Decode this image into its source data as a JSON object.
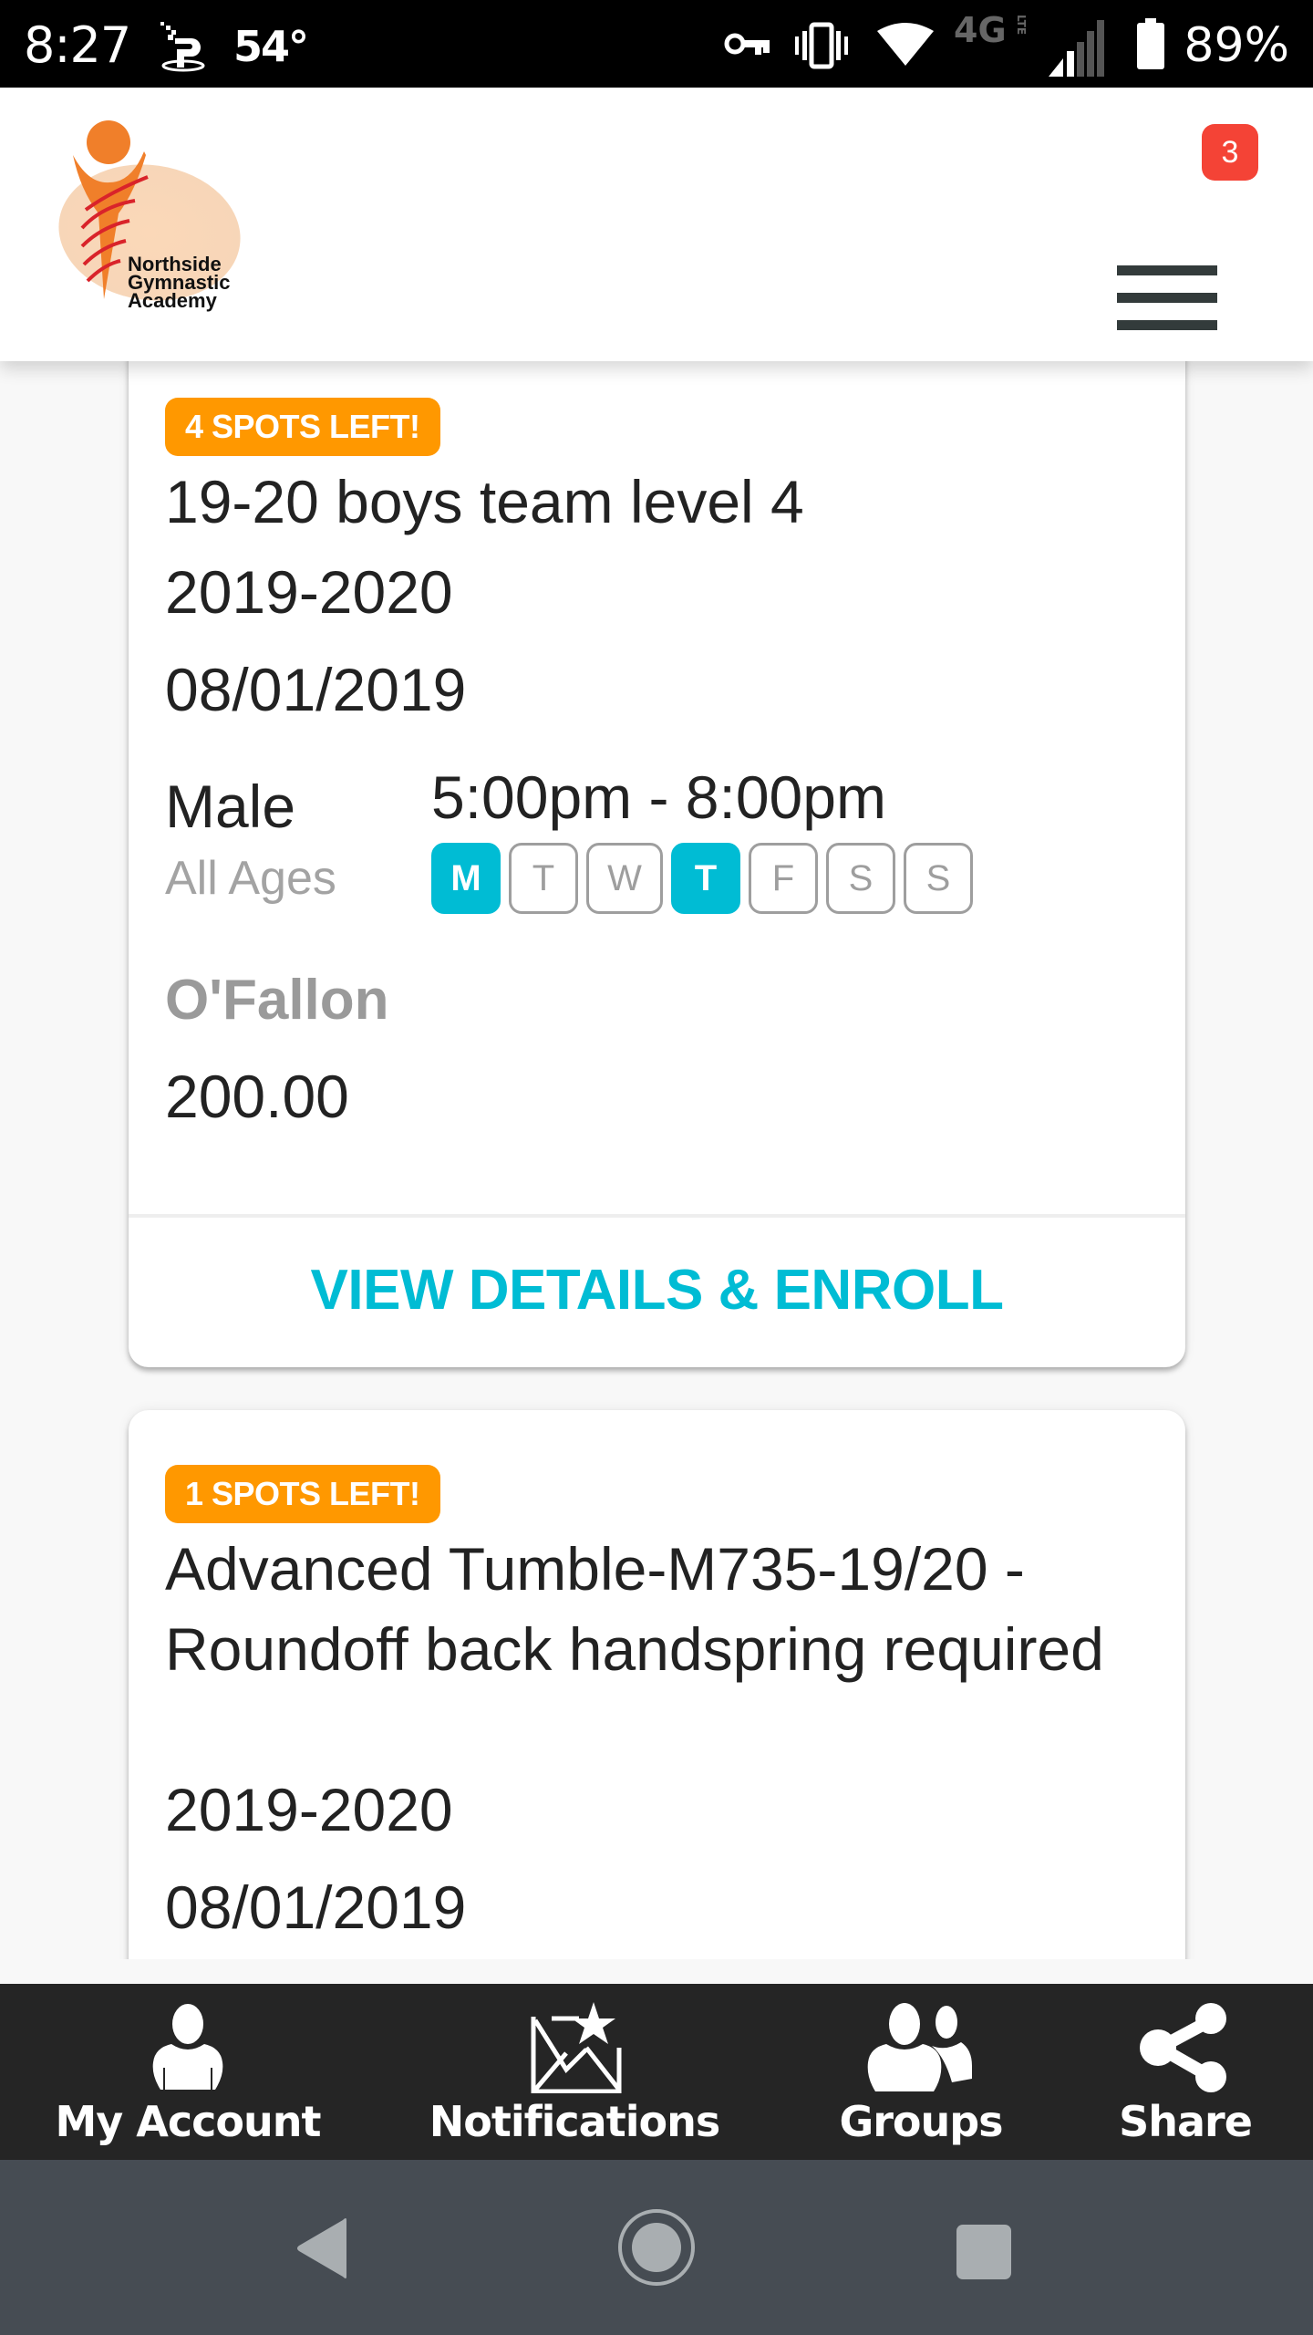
{
  "status_bar": {
    "time": "8:27",
    "temperature": "54°",
    "battery_percent": "89%",
    "network_type": "4G LTE",
    "icons": [
      "carrier-logo-icon",
      "vpn-key-icon",
      "vibrate-icon",
      "wifi-icon",
      "4g-lte-icon",
      "cell-signal-icon",
      "battery-icon"
    ]
  },
  "header": {
    "logo_lines": [
      "Northside",
      "Gymnastic",
      "Academy"
    ],
    "menu_badge_count": "3",
    "colors": {
      "logo_orange": "#f07f2a",
      "badge_red": "#f44336"
    }
  },
  "classes": [
    {
      "spots_badge": "4 SPOTS LEFT!",
      "title": "19-20 boys team level 4",
      "season": "2019-2020",
      "start_date": "08/01/2019",
      "gender": "Male",
      "ages": "All Ages",
      "time": "5:00pm - 8:00pm",
      "days": [
        {
          "label": "M",
          "active": true
        },
        {
          "label": "T",
          "active": false
        },
        {
          "label": "W",
          "active": false
        },
        {
          "label": "T",
          "active": true
        },
        {
          "label": "F",
          "active": false
        },
        {
          "label": "S",
          "active": false
        },
        {
          "label": "S",
          "active": false
        }
      ],
      "location": "O'Fallon",
      "price": "200.00",
      "action_label": "VIEW DETAILS & ENROLL"
    },
    {
      "spots_badge": "1 SPOTS LEFT!",
      "title": "Advanced Tumble-M735-19/20 - Roundoff back handspring required",
      "season": "2019-2020",
      "start_date": "08/01/2019"
    }
  ],
  "tabbar": {
    "items": [
      {
        "label": "My Account",
        "icon": "user-icon"
      },
      {
        "label": "Notifications",
        "icon": "envelope-star-icon"
      },
      {
        "label": "Groups",
        "icon": "group-icon"
      },
      {
        "label": "Share",
        "icon": "share-icon"
      }
    ]
  },
  "navbar": {
    "buttons": [
      "back",
      "home",
      "recents"
    ]
  },
  "colors": {
    "accent_cyan": "#00bcd4",
    "spots_orange": "#ff9800",
    "tabbar_bg": "#252525",
    "navbar_bg": "#464c53"
  }
}
